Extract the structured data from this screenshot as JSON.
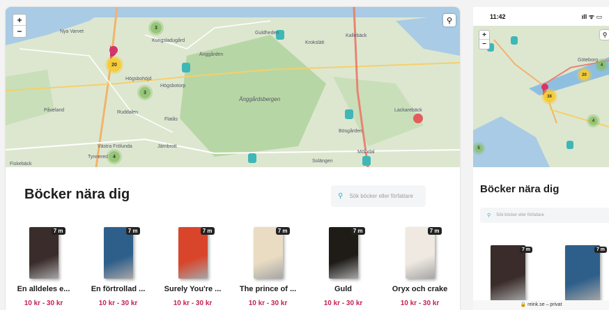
{
  "desktop": {
    "map": {
      "zoom_in": "+",
      "zoom_out": "−",
      "labels": [
        {
          "text": "Nya Varvet"
        },
        {
          "text": "Kungsladugård"
        },
        {
          "text": "Änggården"
        },
        {
          "text": "Högsbohöjd"
        },
        {
          "text": "Högsbotorp"
        },
        {
          "text": "Påveland"
        },
        {
          "text": "Ruddalen"
        },
        {
          "text": "Flatås"
        },
        {
          "text": "Västra Frölunda"
        },
        {
          "text": "Järnbrott"
        },
        {
          "text": "Guldheden"
        },
        {
          "text": "Krokslätt"
        },
        {
          "text": "Kallebäck"
        },
        {
          "text": "Änggårdsbergen"
        },
        {
          "text": "Lackarebäck"
        },
        {
          "text": "Bösgården"
        },
        {
          "text": "Mölndal"
        },
        {
          "text": "Solängen"
        },
        {
          "text": "Fiskebäck"
        },
        {
          "text": "Tynnered"
        }
      ],
      "clusters": [
        {
          "count": "3",
          "color": "green"
        },
        {
          "count": "20",
          "color": "yellow"
        },
        {
          "count": "3",
          "color": "green"
        },
        {
          "count": "4",
          "color": "green"
        }
      ]
    },
    "section_title": "Böcker nära dig",
    "search_placeholder": "Sök böcker eller författare",
    "books": [
      {
        "distance": "7 m",
        "title": "En alldeles e...",
        "price": "10 kr - 30 kr",
        "cover_color": "#3a2c2a"
      },
      {
        "distance": "7 m",
        "title": "En förtrollad ...",
        "price": "10 kr - 30 kr",
        "cover_color": "#2e5f8a"
      },
      {
        "distance": "7 m",
        "title": "Surely You're ...",
        "price": "10 kr - 30 kr",
        "cover_color": "#d9452b"
      },
      {
        "distance": "7 m",
        "title": "The prince of ...",
        "price": "10 kr - 30 kr",
        "cover_color": "#e9dcc2"
      },
      {
        "distance": "7 m",
        "title": "Guld",
        "price": "10 kr - 30 kr",
        "cover_color": "#1f1c18"
      },
      {
        "distance": "7 m",
        "title": "Oryx och crake",
        "price": "10 kr - 30 kr",
        "cover_color": "#efe9e1"
      }
    ]
  },
  "mobile": {
    "time": "11:42",
    "status_icons": "ıll ᯤ ▭",
    "map": {
      "zoom_in": "+",
      "zoom_out": "−",
      "clusters": [
        {
          "count": "38",
          "color": "yellow"
        },
        {
          "count": "20",
          "color": "yellow"
        },
        {
          "count": "4",
          "color": "green"
        },
        {
          "count": "4",
          "color": "green"
        },
        {
          "count": "5",
          "color": "green"
        }
      ],
      "labels": [
        {
          "text": "Göteborg"
        }
      ]
    },
    "section_title": "Böcker nära dig",
    "search_placeholder": "Sök böcker eller författare",
    "books": [
      {
        "distance": "7 m",
        "cover_color": "#3a2c2a"
      },
      {
        "distance": "7 m",
        "cover_color": "#2e5f8a"
      }
    ],
    "footer": "🔒 reink.se – privat"
  }
}
